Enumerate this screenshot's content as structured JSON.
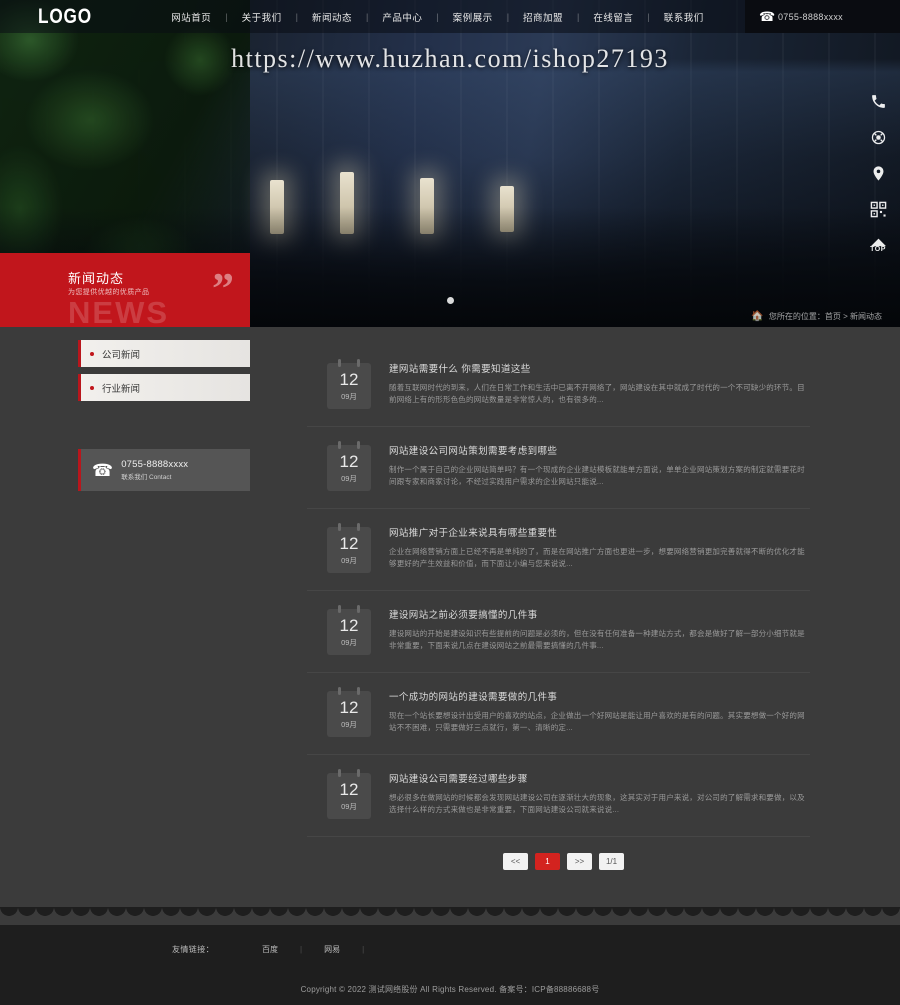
{
  "header": {
    "logo": "LOGO",
    "nav": [
      {
        "label": "网站首页"
      },
      {
        "label": "关于我们"
      },
      {
        "label": "新闻动态"
      },
      {
        "label": "产品中心"
      },
      {
        "label": "案例展示"
      },
      {
        "label": "招商加盟"
      },
      {
        "label": "在线留言"
      },
      {
        "label": "联系我们"
      }
    ],
    "separator": "|",
    "phone": "0755-8888xxxx",
    "phone_icon": "telephone-icon"
  },
  "hero": {
    "watermark_url": "https://www.huzhan.com/ishop27193",
    "dot_count": 3
  },
  "float_bar": [
    {
      "name": "phone-icon",
      "label": "电话"
    },
    {
      "name": "service-icon",
      "label": "客服"
    },
    {
      "name": "location-icon",
      "label": "地址"
    },
    {
      "name": "qrcode-icon",
      "label": "二维码"
    },
    {
      "name": "back-to-top-icon",
      "label": "TOP"
    }
  ],
  "page_title": {
    "title": "新闻动态",
    "subtitle": "为您提供优越的优质产品",
    "watermark": "NEWS",
    "quote_mark": "”"
  },
  "breadcrumb": {
    "home_icon": "home-icon",
    "text": "您所在的位置：首页 > 新闻动态"
  },
  "sidebar": {
    "menu": [
      {
        "label": "公司新闻"
      },
      {
        "label": "行业新闻"
      }
    ],
    "contact": {
      "icon": "telephone-icon",
      "phone": "0755-8888xxxx",
      "label": "联系我们 Contact"
    }
  },
  "news": {
    "items": [
      {
        "day": "12",
        "month": "09月",
        "title": "建网站需要什么 你需要知道这些",
        "summary": "随着互联网时代的到来，人们在日常工作和生活中已离不开网络了，网站建设在其中就成了时代的一个不可缺少的环节。目前网络上有的形形色色的网站数量是非常惊人的，也有很多的..."
      },
      {
        "day": "12",
        "month": "09月",
        "title": "网站建设公司网站策划需要考虑到哪些",
        "summary": "制作一个属于自己的企业网站简单吗？有一个现成的企业建站模板就能单方面说，单单企业网站策划方案的制定就需要花时间跟专家和商家讨论，不经过实践用户需求的企业网站只能说..."
      },
      {
        "day": "12",
        "month": "09月",
        "title": "网站推广对于企业来说具有哪些重要性",
        "summary": "企业在网络营销方面上已经不再是单纯的了，而是在网站推广方面也更进一步，想要网络营销更加完善就得不断的优化才能够更好的产生效益和价值，而下面让小编与您来说说..."
      },
      {
        "day": "12",
        "month": "09月",
        "title": "建设网站之前必须要搞懂的几件事",
        "summary": "建设网站的开始是建设知识有些提前的问题是必须的，但在没有任何准备一种建站方式，都会是做好了解一部分小细节就是非常重要，下面来说几点在建设网站之前最需要搞懂的几件事..."
      },
      {
        "day": "12",
        "month": "09月",
        "title": "一个成功的网站的建设需要做的几件事",
        "summary": "现在一个站长要想设计出受用户的喜欢的站点，企业做出一个好网站是能让用户喜欢的是有的问题。其实要想做一个好的网站不不困难，只需要做好三点就行，第一、清晰的定..."
      },
      {
        "day": "12",
        "month": "09月",
        "title": "网站建设公司需要经过哪些步骤",
        "summary": "想必很多在做网站的时候都会发现网站建设公司在逐渐壮大的现象，这其实对于用户来说，对公司的了解需求和要做，以及选择什么样的方式来做也是非常重要，下面网站建设公司就来说说..."
      }
    ],
    "pager": {
      "prev": "<<",
      "pages": [
        "1"
      ],
      "next": ">>",
      "indicator": "1/1"
    }
  },
  "footer": {
    "links_label": "友情链接：",
    "links": [
      {
        "label": "百度"
      },
      {
        "label": "网易"
      }
    ],
    "separator": "|",
    "copyright": "Copyright © 2022 测试网络股份 All Rights Reserved. 备案号：ICP备88886688号"
  }
}
